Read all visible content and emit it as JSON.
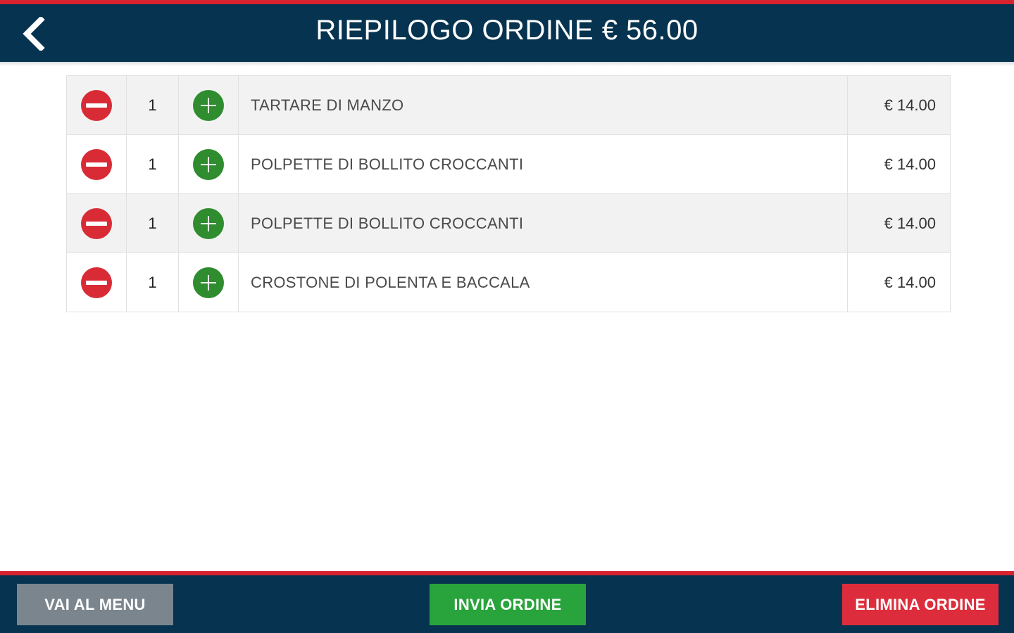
{
  "header": {
    "title": "RIEPILOGO ORDINE € 56.00",
    "back_icon": "chevron-left-icon"
  },
  "order": {
    "items": [
      {
        "qty": "1",
        "name": "TARTARE DI MANZO",
        "price": "€ 14.00"
      },
      {
        "qty": "1",
        "name": "POLPETTE DI BOLLITO CROCCANTI",
        "price": "€ 14.00"
      },
      {
        "qty": "1",
        "name": "POLPETTE DI BOLLITO CROCCANTI",
        "price": "€ 14.00"
      },
      {
        "qty": "1",
        "name": "CROSTONE DI POLENTA E BACCALA",
        "price": "€ 14.00"
      }
    ]
  },
  "footer": {
    "menu_label": "VAI AL MENU",
    "send_label": "INVIA ORDINE",
    "delete_label": "ELIMINA ORDINE"
  },
  "colors": {
    "header_bg": "#06334f",
    "accent_red": "#d7232f",
    "minus_red": "#d82b36",
    "plus_green": "#2f8c2f",
    "btn_gray": "#7a858d",
    "btn_green": "#29a33c",
    "btn_red": "#dd2d3c"
  }
}
